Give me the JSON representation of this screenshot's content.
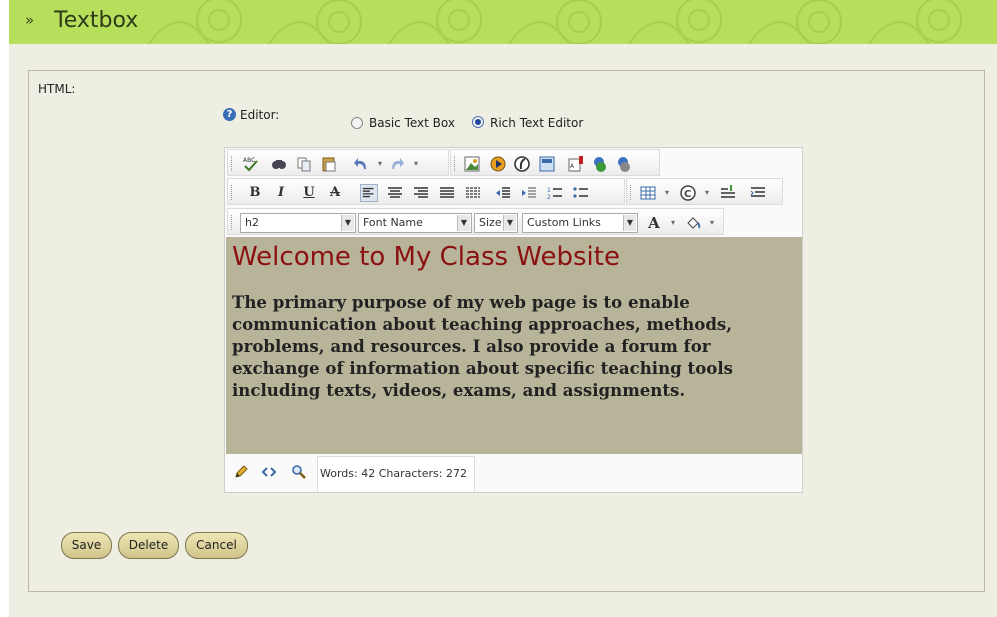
{
  "header": {
    "title": "Textbox",
    "arrows": "»",
    "color": "#b7df5c"
  },
  "form": {
    "html_label": "HTML:",
    "editor_label": "Editor:",
    "help_icon": "?",
    "radio_basic": "Basic Text Box",
    "radio_rich": "Rich Text Editor",
    "selected": "Rich Text Editor"
  },
  "toolbar": {
    "row1": [
      "spellcheck-icon",
      "find-icon",
      "copy-icon",
      "paste-icon",
      "undo-icon",
      "undo-dropdown-icon",
      "redo-icon",
      "redo-dropdown-icon",
      "image-manager-icon",
      "media-icon",
      "flash-icon",
      "document-manager-icon",
      "template-icon",
      "link-icon",
      "unlink-icon"
    ],
    "bold": "B",
    "italic": "I",
    "underline": "U",
    "strike": "A",
    "format_select": "h2",
    "font_select": "Font Name",
    "size_select": "Size",
    "links_select": "Custom Links",
    "forecolor": "A"
  },
  "content": {
    "heading": "Welcome to My Class Website",
    "heading_color": "#8b1010",
    "background_color": "#b8b49a",
    "paragraph": "The primary purpose of my web page is to enable communication about teaching approaches, methods, problems, and resources. I also provide a forum for exchange of information about specific teaching tools including texts, videos, exams, and assignments."
  },
  "footer": {
    "word_count": "Words: 42 Characters: 272"
  },
  "buttons": {
    "save": "Save",
    "delete": "Delete",
    "cancel": "Cancel"
  }
}
